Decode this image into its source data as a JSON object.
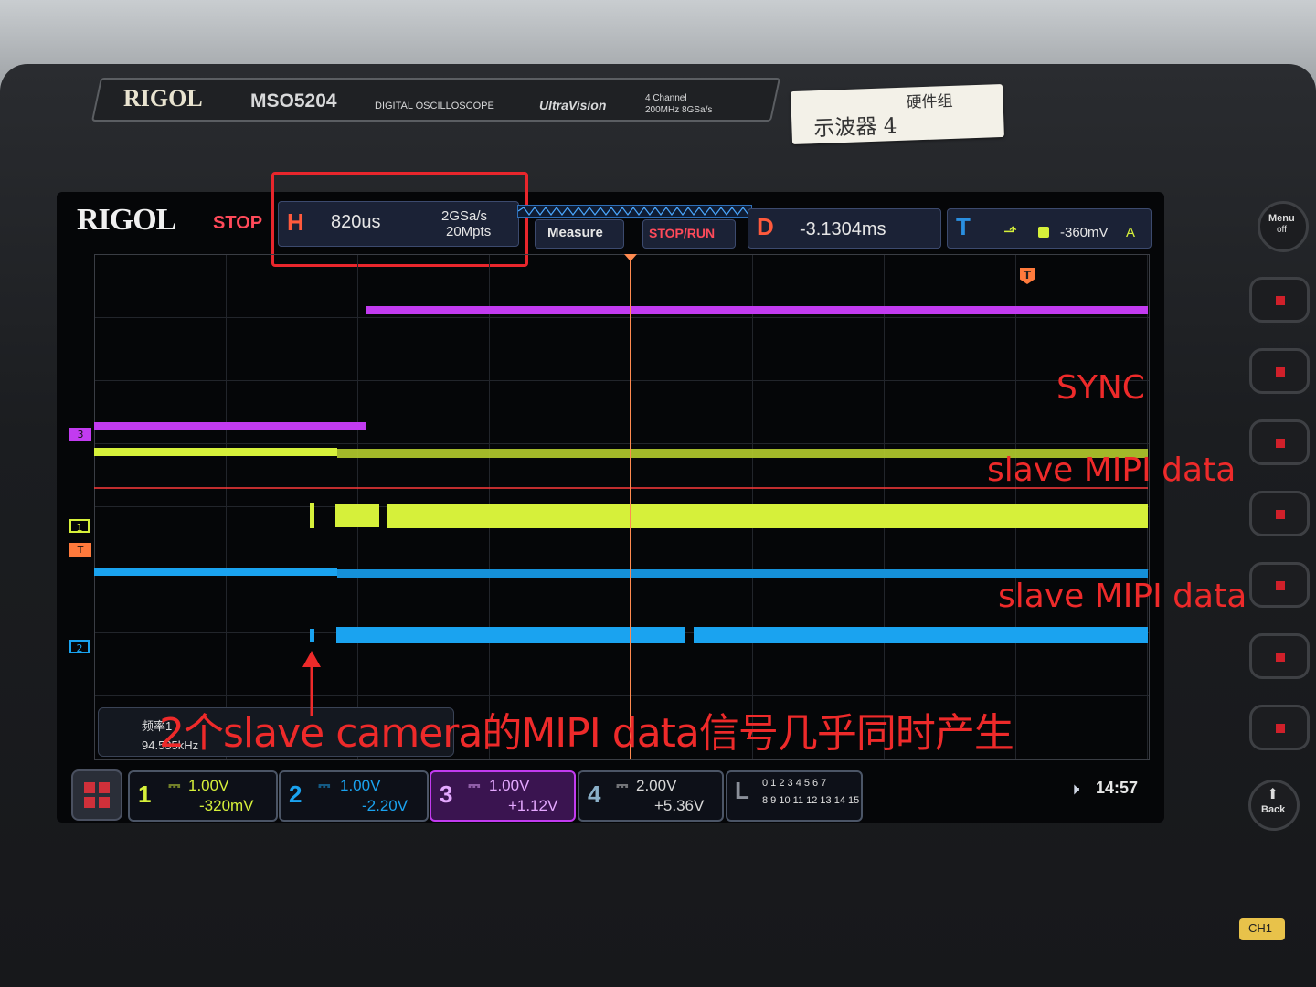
{
  "device": {
    "brand": "RIGOL",
    "model": "MSO5204",
    "type_label": "DIGITAL OSCILLOSCOPE",
    "series_logo": "UltraVision",
    "spec_line1": "4 Channel",
    "spec_line2": "200MHz 8GSa/s",
    "sticker_top": "硬件组",
    "sticker_main": "示波器 4"
  },
  "screen": {
    "logo": "RIGOL",
    "run_state": "STOP",
    "horizontal_label": "H",
    "timebase": "820us",
    "sample_rate": "2GSa/s",
    "memory_depth": "20Mpts",
    "measure_button": "Measure",
    "stop_run_button": "STOP/RUN",
    "delay_label": "D",
    "delay_value": "-3.1304ms",
    "trigger_label": "T",
    "trigger_level": "-360mV",
    "trigger_mode": "A",
    "freq_label": "频率1",
    "freq_value": "94.535kHz",
    "clock": "14:57",
    "logic_label": "L",
    "logic_row1": "0 1 2 3  4 5 6 7",
    "logic_row2": "8 9 10 11  12 13 14 15",
    "markers": {
      "ch3": "3",
      "ch1": "1",
      "trig": "T",
      "ch2": "2"
    },
    "channels": [
      {
        "num": "1",
        "scale": "1.00V",
        "offset": "-320mV",
        "color": "#d6f03a"
      },
      {
        "num": "2",
        "scale": "1.00V",
        "offset": "-2.20V",
        "color": "#1aa3f0"
      },
      {
        "num": "3",
        "scale": "1.00V",
        "offset": "+1.12V",
        "color": "#c23bf0"
      },
      {
        "num": "4",
        "scale": "2.00V",
        "offset": "+5.36V",
        "color": "#3a8f3a"
      }
    ]
  },
  "side_buttons": {
    "menu": "Menu",
    "menu_sub": "off",
    "back": "Back",
    "ch1_label": "CH1"
  },
  "annotations": {
    "sync": "SYNC",
    "mipi_1": "slave MIPI data",
    "mipi_2": "slave MIPI data",
    "caption": "2个slave camera的MIPI data信号几乎同时产生"
  },
  "colors": {
    "annotation": "#ee2a2a",
    "ch1": "#d6f03a",
    "ch2": "#1aa3f0",
    "ch3": "#c23bf0",
    "trigger": "#ff7a3c"
  }
}
